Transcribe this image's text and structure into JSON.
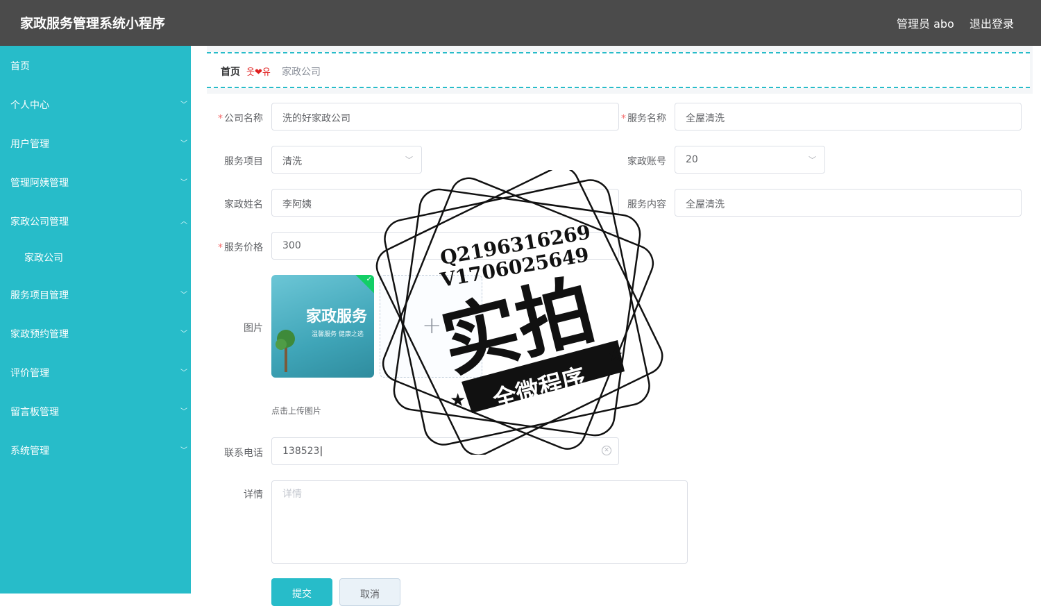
{
  "header": {
    "title": "家政服务管理系统小程序",
    "admin": "管理员 abo",
    "logout": "退出登录"
  },
  "sidebar": {
    "items": [
      {
        "label": "首页"
      },
      {
        "label": "个人中心"
      },
      {
        "label": "用户管理"
      },
      {
        "label": "管理阿姨管理"
      },
      {
        "label": "家政公司管理"
      },
      {
        "label": "家政公司"
      },
      {
        "label": "服务项目管理"
      },
      {
        "label": "家政预约管理"
      },
      {
        "label": "评价管理"
      },
      {
        "label": "留言板管理"
      },
      {
        "label": "系统管理"
      }
    ]
  },
  "breadcrumb": {
    "home": "首页",
    "separator": "웃❤유",
    "current": "家政公司"
  },
  "form": {
    "company_name": {
      "label": "公司名称",
      "value": "洗的好家政公司"
    },
    "service_name": {
      "label": "服务名称",
      "value": "全屋清洗"
    },
    "service_item": {
      "label": "服务项目",
      "value": "清洗"
    },
    "housekeeper_account": {
      "label": "家政账号",
      "value": "20"
    },
    "housekeeper_name": {
      "label": "家政姓名",
      "value": "李阿姨"
    },
    "service_content": {
      "label": "服务内容",
      "value": "全屋清洗"
    },
    "service_price": {
      "label": "服务价格",
      "value": "300"
    },
    "image": {
      "label": "图片",
      "thumb_title": "家政服务",
      "thumb_sub": "温馨服务 健康之选",
      "tip": "点击上传图片"
    },
    "phone": {
      "label": "联系电话",
      "value": "138523"
    },
    "details": {
      "label": "详情",
      "placeholder": "详情"
    },
    "submit": "提交",
    "cancel": "取消"
  },
  "watermark": {
    "line1": "Q2196316269",
    "line2": "V1706025649",
    "main": "实拍",
    "banner": "全微程序"
  }
}
